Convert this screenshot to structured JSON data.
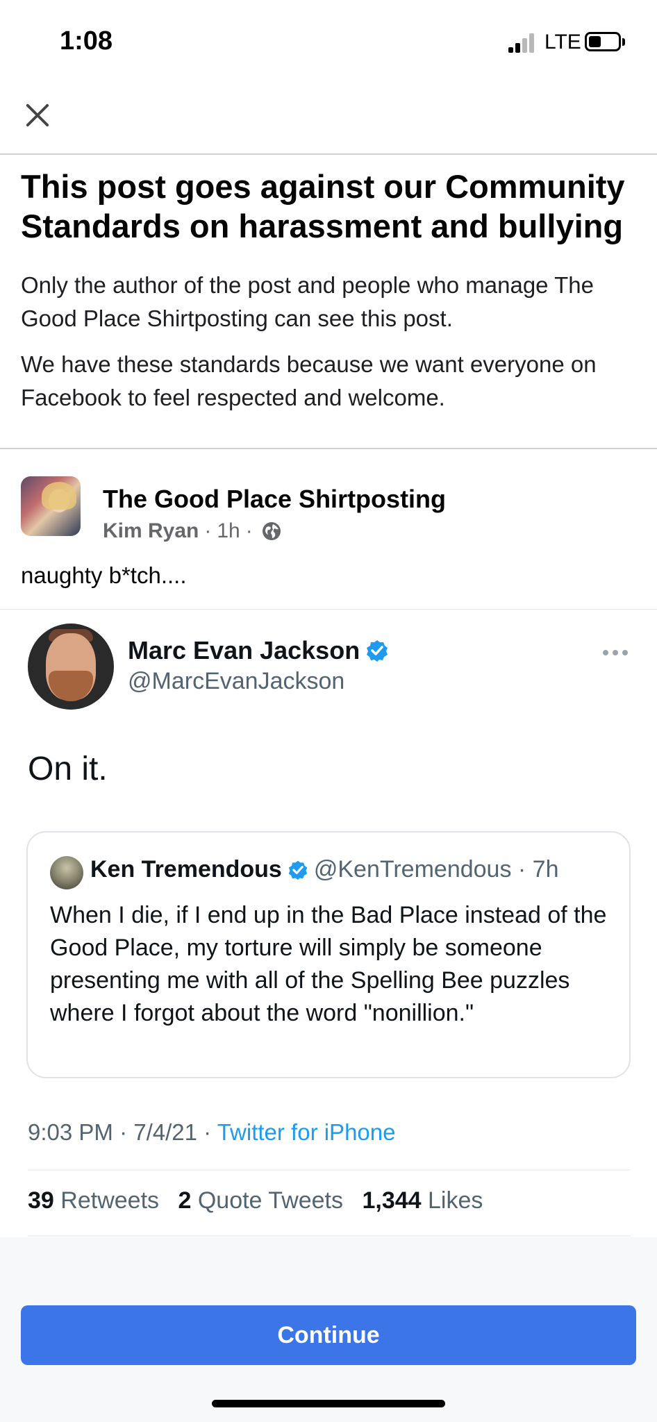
{
  "status_bar": {
    "time": "1:08",
    "network": "LTE"
  },
  "notice": {
    "title": "This post goes against our Community Standards on harassment and bullying",
    "paragraph1": "Only the author of the post and people who manage The Good Place Shirtposting can see this post.",
    "paragraph2": "We have these standards because we want everyone on Facebook to feel respected and welcome."
  },
  "post": {
    "group_name": "The Good Place Shirtposting",
    "author": "Kim Ryan",
    "time": "1h",
    "text": "naughty b*tch...."
  },
  "tweet": {
    "name": "Marc Evan Jackson",
    "handle": "@MarcEvanJackson",
    "text": "On it.",
    "quoted": {
      "name": "Ken Tremendous",
      "handle": "@KenTremendous · 7h",
      "text": "When I die, if I end up in the Bad Place instead of the Good Place, my torture will simply be someone presenting me with all of the Spelling Bee puzzles where I forgot about the word \"nonillion.\""
    },
    "timestamp": "9:03 PM · 7/4/21 · ",
    "source": "Twitter for iPhone",
    "retweets_count": "39",
    "retweets_label": "Retweets",
    "quotes_count": "2",
    "quotes_label": "Quote Tweets",
    "likes_count": "1,344",
    "likes_label": "Likes"
  },
  "continue_button": {
    "label": "Continue"
  },
  "colors": {
    "facebook_blue": "#3b75e8",
    "twitter_blue": "#1d9bf0",
    "verified_blue": "#1d9bf0"
  }
}
